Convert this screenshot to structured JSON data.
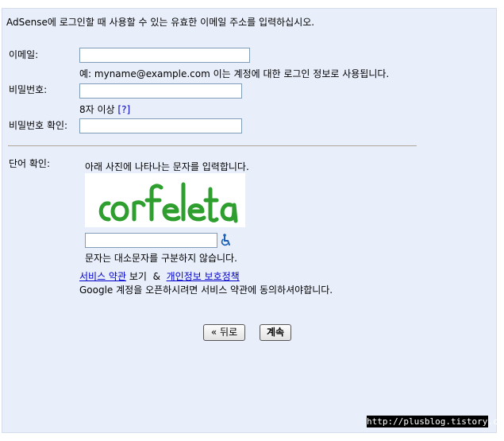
{
  "intro": "AdSense에 로그인할 때 사용할 수 있는 유효한 이메일 주소를 입력하십시오.",
  "email": {
    "label": "이메일:",
    "value": "",
    "hint": "예: myname@example.com 이는 계정에 대한 로그인 정보로 사용됩니다."
  },
  "password": {
    "label": "비밀번호:",
    "value": "",
    "hint": "8자 이상",
    "help_link": "[?]"
  },
  "password_confirm": {
    "label": "비밀번호 확인:",
    "value": ""
  },
  "captcha": {
    "label": "단어 확인:",
    "instruction": "아래 사진에 나타나는 문자를 입력합니다.",
    "image_text": "corfeleta",
    "value": "",
    "note": "문자는 대소문자를 구분하지 않습니다.",
    "accessibility_icon": "wheelchair-icon"
  },
  "terms": {
    "tos_link": "서비스 약관",
    "view": "보기",
    "amp": "&",
    "privacy_link": "개인정보 보호정책",
    "agreement": "Google 계정을 오픈하시려면 서비스 약관에 동의하셔야합니다."
  },
  "buttons": {
    "back": "« 뒤로",
    "continue": "계속"
  },
  "watermark": "http://plusblog.tistory.com/",
  "colors": {
    "panel_bg": "#e8eefa",
    "link": "#0000cc",
    "captcha_green": "#2e9e2e"
  }
}
